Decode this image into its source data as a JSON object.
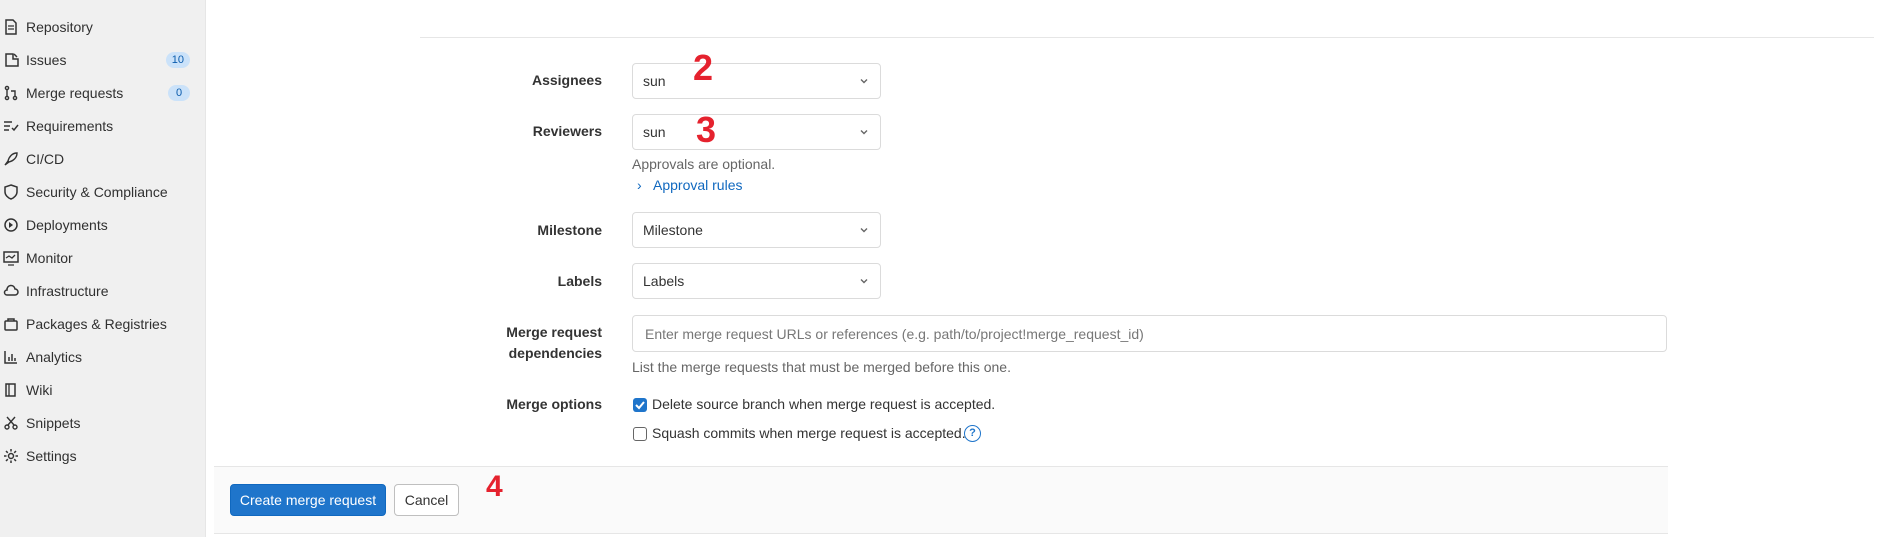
{
  "sidebar": {
    "items": [
      {
        "label": "Repository",
        "icon": "repository-icon"
      },
      {
        "label": "Issues",
        "icon": "issues-icon",
        "badge": "10"
      },
      {
        "label": "Merge requests",
        "icon": "merge-request-icon",
        "badge": "0"
      },
      {
        "label": "Requirements",
        "icon": "requirements-icon"
      },
      {
        "label": "CI/CD",
        "icon": "rocket-icon"
      },
      {
        "label": "Security & Compliance",
        "icon": "shield-icon"
      },
      {
        "label": "Deployments",
        "icon": "deployments-icon"
      },
      {
        "label": "Monitor",
        "icon": "monitor-icon"
      },
      {
        "label": "Infrastructure",
        "icon": "cloud-icon"
      },
      {
        "label": "Packages & Registries",
        "icon": "package-icon"
      },
      {
        "label": "Analytics",
        "icon": "chart-icon"
      },
      {
        "label": "Wiki",
        "icon": "book-icon"
      },
      {
        "label": "Snippets",
        "icon": "scissors-icon"
      },
      {
        "label": "Settings",
        "icon": "gear-icon"
      }
    ]
  },
  "form": {
    "assignees": {
      "label": "Assignees",
      "value": "sun"
    },
    "reviewers": {
      "label": "Reviewers",
      "value": "sun"
    },
    "approvals_help": "Approvals are optional.",
    "approval_rules_link": "Approval rules",
    "milestone": {
      "label": "Milestone",
      "value": "Milestone"
    },
    "labels": {
      "label": "Labels",
      "value": "Labels"
    },
    "dependencies": {
      "label_line1": "Merge request",
      "label_line2": "dependencies",
      "placeholder": "Enter merge request URLs or references (e.g. path/to/project!merge_request_id)",
      "help": "List the merge requests that must be merged before this one."
    },
    "merge_options": {
      "label": "Merge options",
      "delete_source": {
        "label": "Delete source branch when merge request is accepted.",
        "checked": true
      },
      "squash": {
        "label": "Squash commits when merge request is accepted.",
        "checked": false
      },
      "help_icon": "?"
    }
  },
  "actions": {
    "create_label": "Create merge request",
    "cancel_label": "Cancel"
  },
  "annotations": {
    "a2": "2",
    "a3": "3",
    "a4": "4"
  },
  "colors": {
    "primary": "#1f75cb",
    "annotation": "#e5222e",
    "link": "#1068bf"
  }
}
